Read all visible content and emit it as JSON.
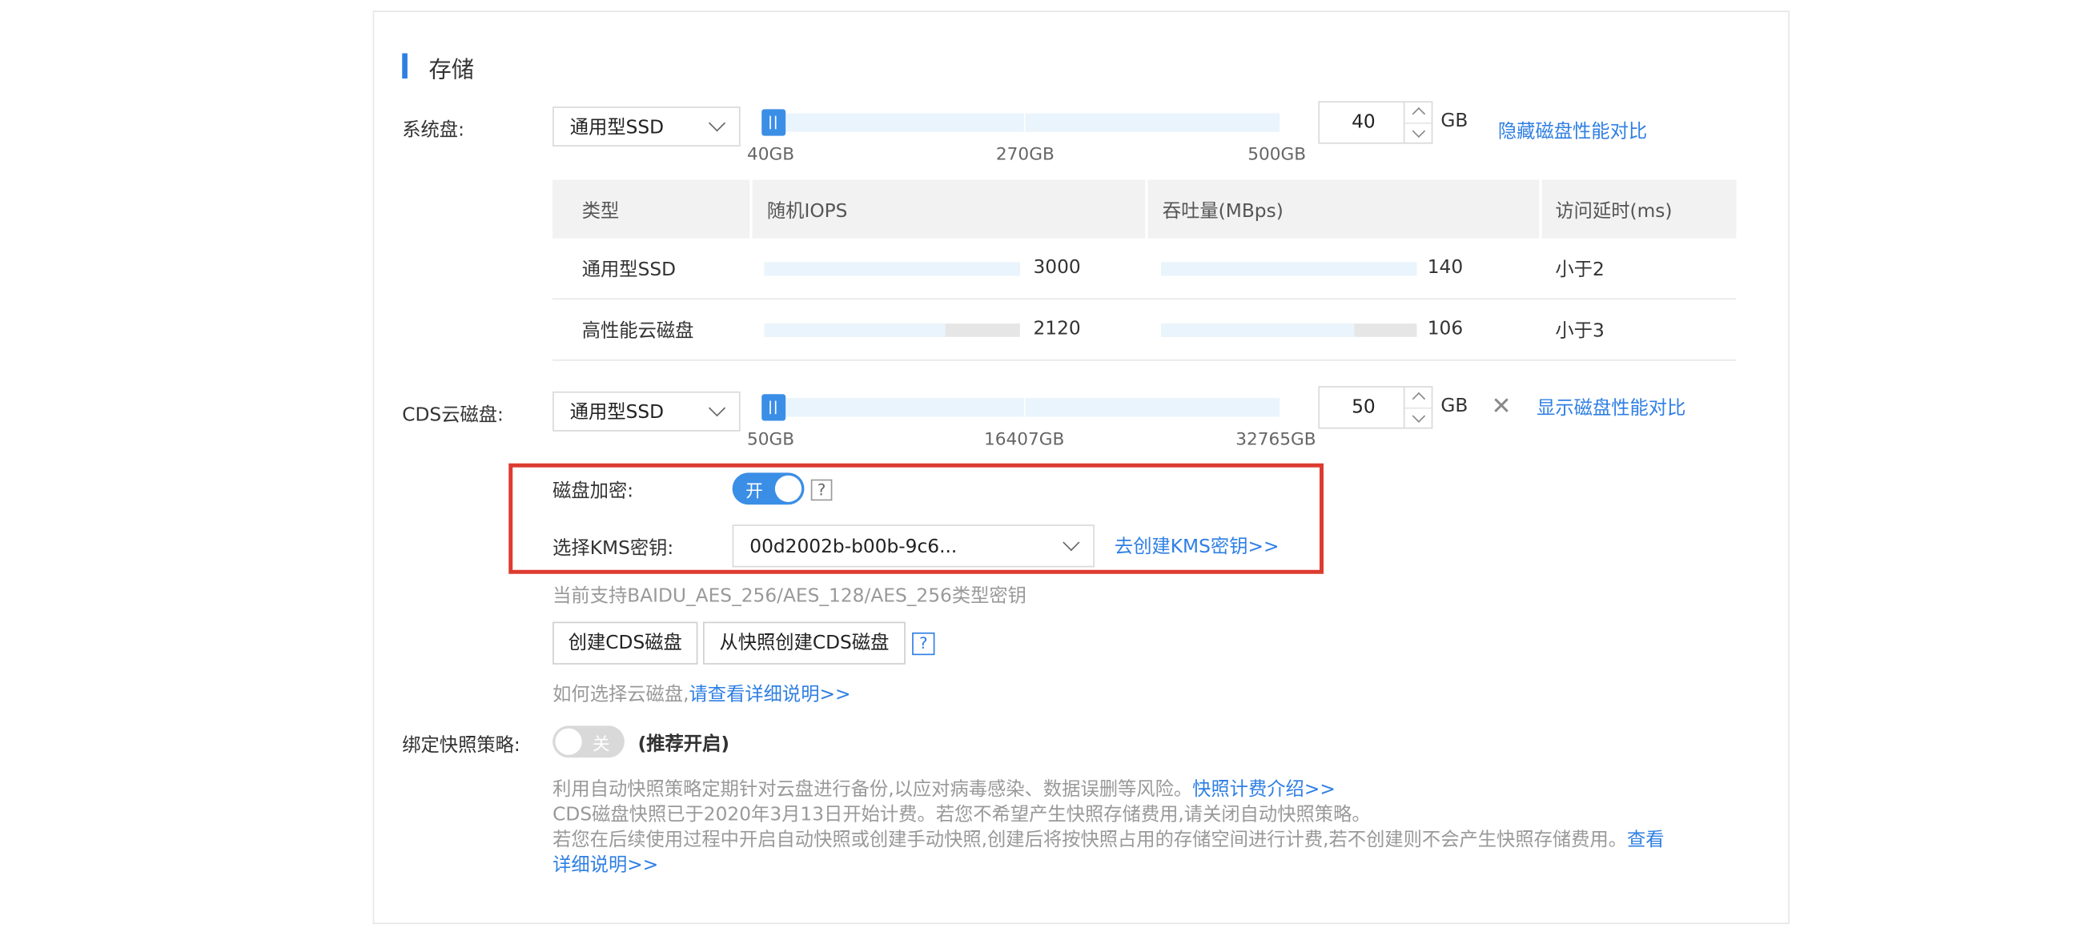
{
  "section": {
    "title": "存储"
  },
  "system_disk": {
    "label": "系统盘:",
    "type": "通用型SSD",
    "ticks": [
      "40GB",
      "270GB",
      "500GB"
    ],
    "value": "40",
    "unit": "GB",
    "toggle_link": "隐藏磁盘性能对比"
  },
  "perf_table": {
    "headers": [
      "类型",
      "随机IOPS",
      "吞吐量(MBps)",
      "访问延时(ms)"
    ],
    "rows": [
      {
        "type": "通用型SSD",
        "iops": "3000",
        "iops_frac": 1.0,
        "throughput": "140",
        "throughput_frac": 1.0,
        "latency": "小于2"
      },
      {
        "type": "高性能云磁盘",
        "iops": "2120",
        "iops_frac": 0.707,
        "throughput": "106",
        "throughput_frac": 0.757,
        "latency": "小于3"
      }
    ]
  },
  "cds_disk": {
    "label": "CDS云磁盘:",
    "type": "通用型SSD",
    "ticks": [
      "50GB",
      "16407GB",
      "32765GB"
    ],
    "value": "50",
    "unit": "GB",
    "toggle_link": "显示磁盘性能对比"
  },
  "encryption": {
    "label": "磁盘加密:",
    "toggle_text": "开",
    "help": "?",
    "kms_label": "选择KMS密钥:",
    "kms_value": "00d2002b-b00b-9c6...",
    "kms_link": "去创建KMS密钥>>",
    "hint": "当前支持BAIDU_AES_256/AES_128/AES_256类型密钥"
  },
  "buttons": {
    "create_cds": "创建CDS磁盘",
    "create_from_snapshot": "从快照创建CDS磁盘",
    "help": "?"
  },
  "how_to": {
    "text": "如何选择云磁盘,",
    "link": "请查看详细说明>>"
  },
  "snapshot": {
    "label": "绑定快照策略:",
    "toggle_text": "关",
    "recommend": "(推荐开启)",
    "desc1": "利用自动快照策略定期针对云盘进行备份,以应对病毒感染、数据误删等风险。",
    "desc1_link": "快照计费介绍>>",
    "desc2": "CDS磁盘快照已于2020年3月13日开始计费。若您不希望产生快照存储费用,请关闭自动快照策略。",
    "desc3": "若您在后续使用过程中开启自动快照或创建手动快照,创建后将按快照占用的存储空间进行计费,若不创建则不会产生快照存储费用。",
    "desc3_link_a": "查看",
    "desc3_link_b": "详细说明>>"
  }
}
